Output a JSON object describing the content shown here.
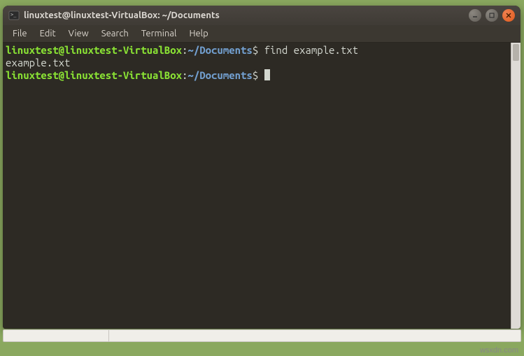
{
  "window": {
    "title": "linuxtest@linuxtest-VirtualBox: ~/Documents"
  },
  "menubar": {
    "items": [
      "File",
      "Edit",
      "View",
      "Search",
      "Terminal",
      "Help"
    ]
  },
  "terminal": {
    "lines": [
      {
        "type": "prompt",
        "user": "linuxtest@linuxtest-VirtualBox",
        "colon": ":",
        "path": "~/Documents",
        "dollar": "$",
        "command": " find example.txt"
      },
      {
        "type": "output",
        "text": "example.txt"
      },
      {
        "type": "prompt",
        "user": "linuxtest@linuxtest-VirtualBox",
        "colon": ":",
        "path": "~/Documents",
        "dollar": "$",
        "command": " ",
        "cursor": true
      }
    ]
  },
  "watermark": "wsxdn.com"
}
